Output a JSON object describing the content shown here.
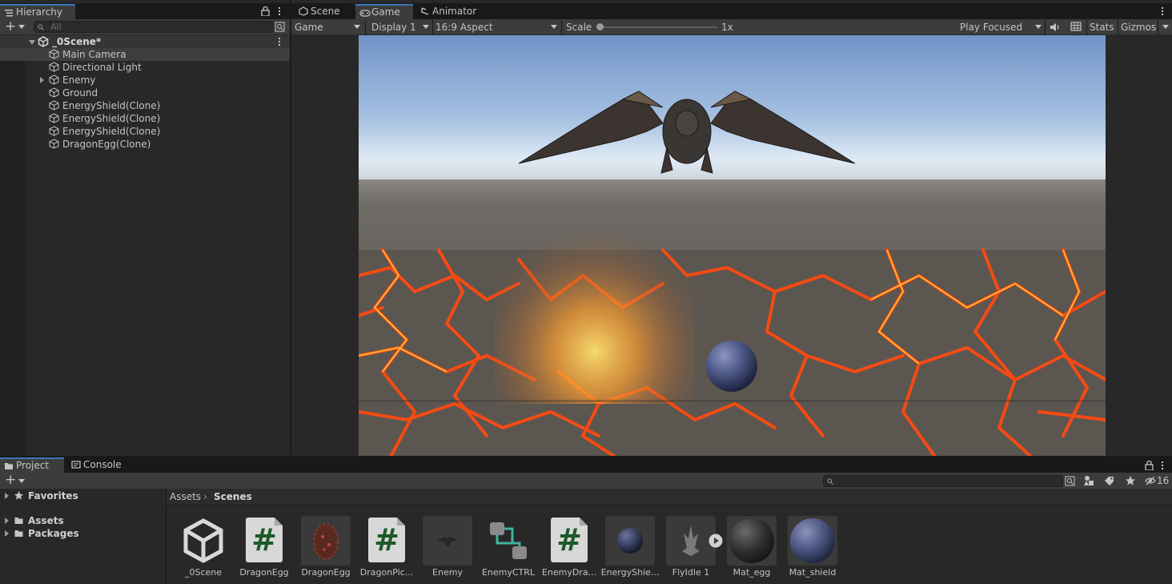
{
  "hierarchy": {
    "tab_label": "Hierarchy",
    "search_placeholder": "All",
    "scene_name": "_0Scene*",
    "items": [
      {
        "label": "Main Camera"
      },
      {
        "label": "Directional Light"
      },
      {
        "label": "Enemy"
      },
      {
        "label": "Ground"
      },
      {
        "label": "EnergyShield(Clone)"
      },
      {
        "label": "EnergyShield(Clone)"
      },
      {
        "label": "EnergyShield(Clone)"
      },
      {
        "label": "DragonEgg(Clone)"
      }
    ]
  },
  "center_tabs": [
    {
      "label": "Scene"
    },
    {
      "label": "Game"
    },
    {
      "label": "Animator"
    }
  ],
  "game_toolbar": {
    "mode": "Game",
    "display": "Display 1",
    "aspect": "16:9 Aspect",
    "scale_label": "Scale",
    "scale_value": "1x",
    "play_mode": "Play Focused",
    "stats": "Stats",
    "gizmos": "Gizmos"
  },
  "bottom_tabs": [
    {
      "label": "Project"
    },
    {
      "label": "Console"
    }
  ],
  "project": {
    "hidden_count": "16",
    "tree": {
      "favorites": "Favorites",
      "assets": "Assets",
      "packages": "Packages"
    },
    "breadcrumb": [
      "Assets",
      "Scenes"
    ],
    "assets": [
      {
        "label": "_0Scene",
        "kind": "scene"
      },
      {
        "label": "DragonEgg",
        "kind": "script"
      },
      {
        "label": "DragonEgg",
        "kind": "prefab-egg"
      },
      {
        "label": "DragonPic...",
        "kind": "script"
      },
      {
        "label": "Enemy",
        "kind": "prefab-dragon"
      },
      {
        "label": "EnemyCTRL",
        "kind": "animator-controller"
      },
      {
        "label": "EnemyDra...",
        "kind": "script"
      },
      {
        "label": "EnergyShie...",
        "kind": "prefab-sphere"
      },
      {
        "label": "FlyIdle 1",
        "kind": "animation-clip"
      },
      {
        "label": "Mat_egg",
        "kind": "material-dark"
      },
      {
        "label": "Mat_shield",
        "kind": "material-blue"
      }
    ]
  },
  "colors": {
    "accent": "#3a79bb",
    "panel": "#282828",
    "toolbar": "#3c3c3c",
    "selected_row": "#3e3e3e",
    "script_hash": "#1e5a2a",
    "lava": "#ff6a1a"
  }
}
